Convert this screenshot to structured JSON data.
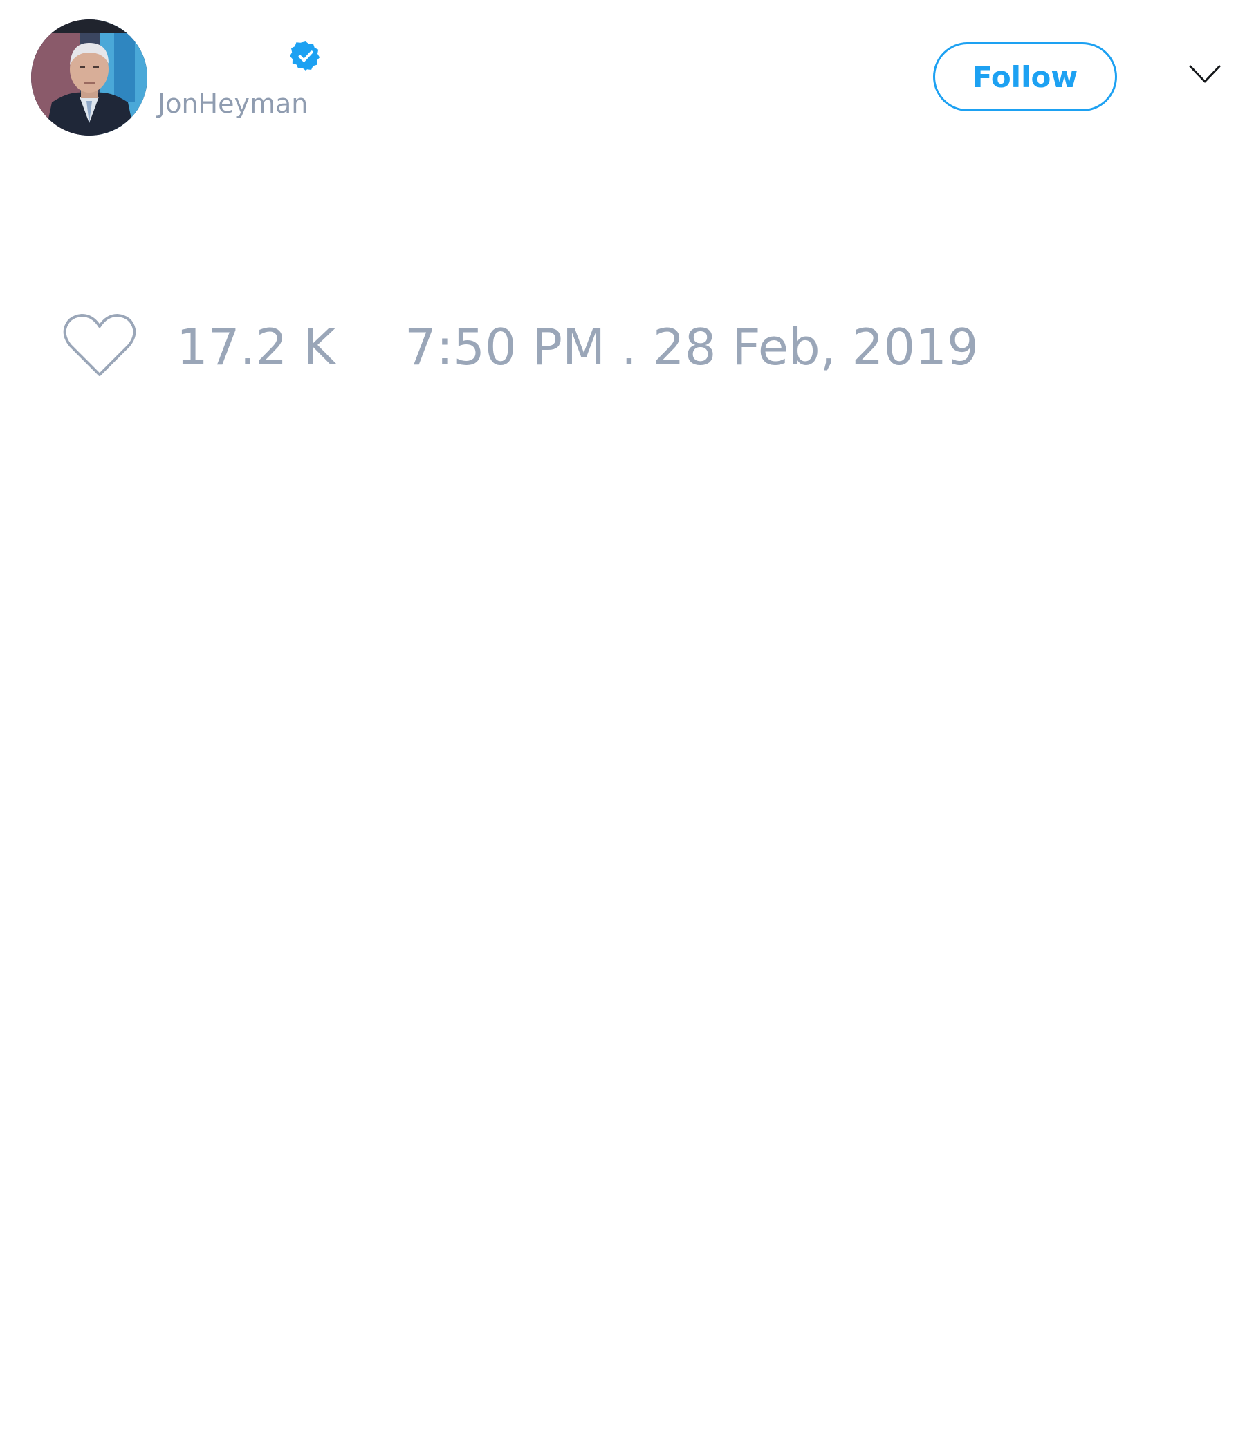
{
  "tweet": {
    "author": {
      "display_name": "",
      "handle": "JonHeyman",
      "verified_icon": "verified-badge-icon",
      "avatar_icon": "avatar-photo"
    },
    "follow_label": "Follow",
    "menu_icon": "chevron-down-icon",
    "likes": {
      "icon": "heart-icon",
      "count": "17.2 K"
    },
    "timestamp": "7:50 PM . 28 Feb, 2019"
  },
  "colors": {
    "accent": "#1da1f2",
    "muted_text": "#9aa6b8",
    "handle_text": "#8f9cb0",
    "background": "#ffffff"
  }
}
